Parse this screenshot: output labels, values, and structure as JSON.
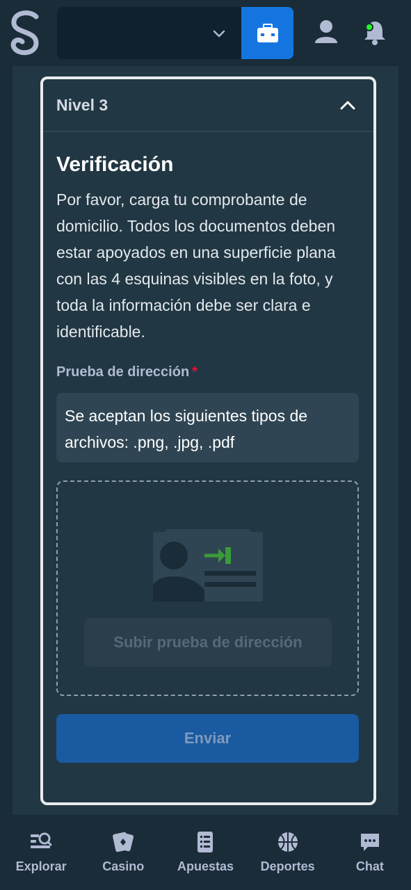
{
  "header": {
    "logo_icon": "stake-s-logo-icon",
    "currency_selector": {
      "selected_value": ""
    },
    "icons": [
      "chevron-down-icon",
      "wallet-icon",
      "user-icon",
      "bell-icon"
    ]
  },
  "card": {
    "level_label": "Nivel 3",
    "title": "Verificación",
    "description": "Por favor, carga tu comprobante de domicilio. Todos los documentos deben estar apoyados en una superficie plana con las 4 esquinas visibles en la foto, y toda la información debe ser clara e identificable.",
    "field_label": "Prueba de dirección",
    "required_mark": "*",
    "info_text": "Se aceptan los siguientes tipos de archivos: .png, .jpg, .pdf",
    "upload_button": "Subir prueba de dirección",
    "submit_button": "Enviar"
  },
  "bottom_nav": {
    "items": [
      {
        "label": "Explorar",
        "icon": "browse-icon"
      },
      {
        "label": "Casino",
        "icon": "casino-cards-icon"
      },
      {
        "label": "Apuestas",
        "icon": "bets-list-icon"
      },
      {
        "label": "Deportes",
        "icon": "basketball-icon"
      },
      {
        "label": "Chat",
        "icon": "chat-icon"
      }
    ]
  },
  "colors": {
    "background": "#1a2c38",
    "card": "#213743",
    "accent_blue": "#1475e1",
    "submit_disabled": "#1a5aa1",
    "required_red": "#e9113c",
    "arrow_green": "#3a9b3a"
  }
}
